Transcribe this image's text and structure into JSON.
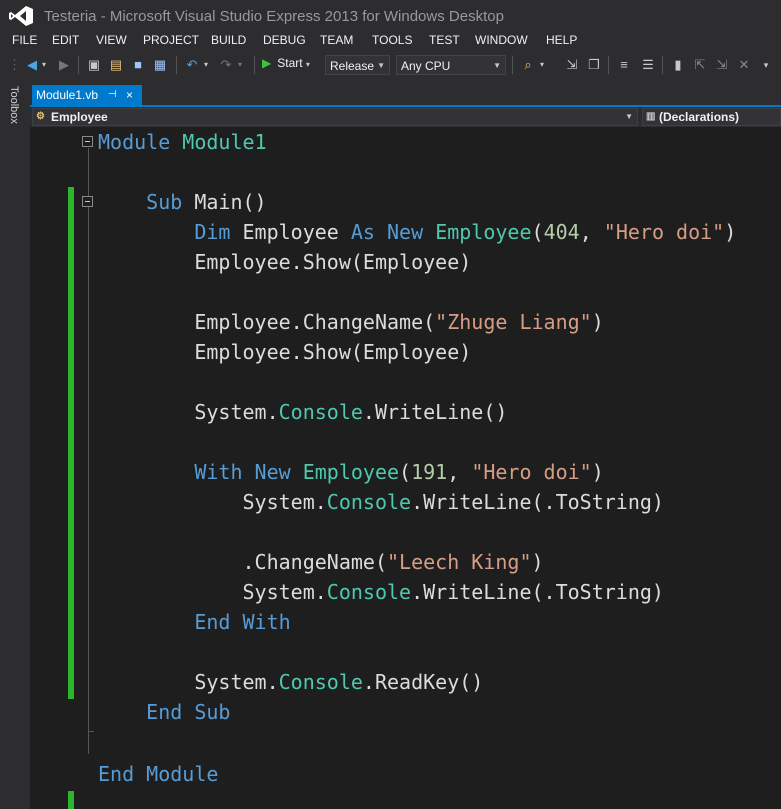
{
  "window": {
    "title": "Testeria - Microsoft Visual Studio Express 2013 for Windows Desktop"
  },
  "menu": [
    "FILE",
    "EDIT",
    "VIEW",
    "PROJECT",
    "BUILD",
    "DEBUG",
    "TEAM",
    "TOOLS",
    "TEST",
    "WINDOW",
    "HELP"
  ],
  "toolbar": {
    "start_label": "Start",
    "configuration": "Release",
    "platform": "Any CPU"
  },
  "toolbox": {
    "label": "Toolbox"
  },
  "tab": {
    "label": "Module1.vb",
    "pin": "⊣",
    "close": "×"
  },
  "nav": {
    "left": "Employee",
    "right": "(Declarations)"
  },
  "code": {
    "module_kw": "Module",
    "module_name": "Module1",
    "sub_kw": "Sub",
    "sub_name": "Main()",
    "dim_kw": "Dim",
    "employee": "Employee",
    "as_kw": "As",
    "new_kw": "New",
    "num404": "404",
    "num191": "191",
    "str_hero": "\"Hero doi\"",
    "str_zhuge": "\"Zhuge Liang\"",
    "str_leech": "\"Leech King\"",
    "show_call": "Employee.Show(Employee)",
    "changename_prefix": "Employee.ChangeName(",
    "system": "System.",
    "console": "Console",
    "writeline_empty": ".WriteLine()",
    "writeline_tostring": ".WriteLine(.ToString)",
    "readkey": ".ReadKey()",
    "with_kw": "With",
    "changename_with": ".ChangeName(",
    "end_with": "End With",
    "end_sub": "End Sub",
    "end_module": "End Module",
    "open_paren": "(",
    "close_paren": ")",
    "comma": ", "
  },
  "colors": {
    "accent": "#007acc",
    "keyword": "#569cd6",
    "type": "#4ec9b0",
    "string": "#d69d85",
    "number": "#b5cea8",
    "change_bar": "#2bb52b"
  }
}
